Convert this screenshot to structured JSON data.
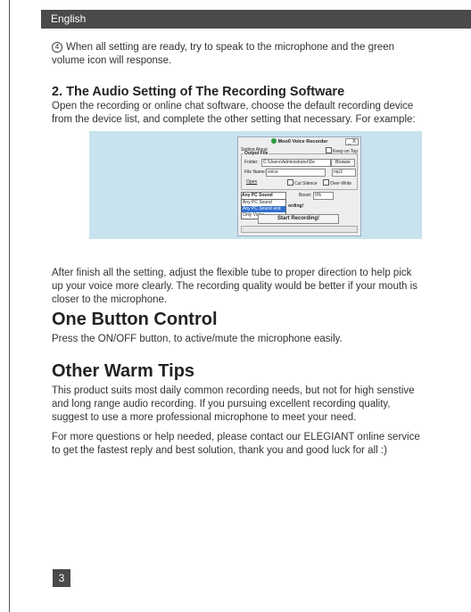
{
  "header": {
    "language": "English"
  },
  "step4": {
    "number": "4",
    "line1": "When all setting are ready, try to speak to the microphone and the green",
    "line2": "volume icon will response."
  },
  "section2": {
    "heading": "2. The Audio Setting of The Recording Software",
    "line1": "Open the recording or online chat software, choose the default recording device",
    "line2": "from the device list, and complete the other setting that necessary. For example:"
  },
  "screenshot": {
    "app_title": "Moo0 Voice Recorder",
    "window_buttons": "_ X",
    "menu": "Setting  About",
    "keep_on_top": "Keep on Top",
    "output_file_label": "Output File",
    "folder_label": "Folder:",
    "folder_value": "C:\\Users\\Administrator\\De",
    "browse_button": "Browse",
    "file_name_label": "File Name:",
    "file_name_value": "voice",
    "format_value": "mp3",
    "open_link": "Open",
    "cut_silence": "Cut Silence",
    "over_write": "Over-Write",
    "source_selected": "Any PC Sound",
    "boost_label": "Boost:",
    "boost_value": "0%",
    "source_options": [
      "Any PC Sound",
      "Any PC Sound and Voice",
      "Only Voice"
    ],
    "recording_status": "ording!",
    "start_button": "Start Recording!"
  },
  "after_setting": {
    "line1": "After finish all the setting, adjust the flexible tube to proper direction to help pick",
    "line2": "up your voice more clearly. The recording quality would be better if your mouth is",
    "line3": "closer to the microphone."
  },
  "one_button": {
    "heading": "One Button Control",
    "text": "Press the ON/OFF button, to active/mute the microphone easily."
  },
  "warm_tips": {
    "heading": "Other Warm Tips",
    "p1_line1": "This product suits most daily common recording needs, but not for high senstive",
    "p1_line2": "and long range audio recording. If you pursuing excellent recording quality,",
    "p1_line3": "suggest to use a more professional microphone to meet your need.",
    "p2_line1": "For more questions or help needed, please contact our ELEGIANT online service",
    "p2_line2": "to get the fastest reply and best solution, thank you and good luck for all :)"
  },
  "page_number": "3"
}
